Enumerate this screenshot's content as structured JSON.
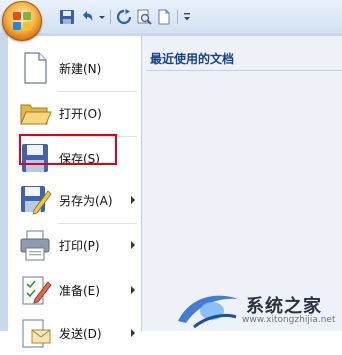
{
  "titlebar": {
    "quick_access": [
      "save-icon",
      "undo-icon",
      "redo-icon",
      "print-preview-icon",
      "new-doc-icon",
      "customize-dropdown-icon"
    ]
  },
  "office_button": {
    "icon": "office-logo-icon"
  },
  "menu": {
    "items": [
      {
        "label": "新建(N)",
        "icon": "new-document-icon",
        "has_submenu": false
      },
      {
        "label": "打开(O)",
        "icon": "open-folder-icon",
        "has_submenu": false,
        "highlighted": true
      },
      {
        "label": "保存(S)",
        "icon": "save-disk-icon",
        "has_submenu": false
      },
      {
        "label": "另存为(A)",
        "icon": "save-as-icon",
        "has_submenu": true
      },
      {
        "label": "打印(P)",
        "icon": "printer-icon",
        "has_submenu": true
      },
      {
        "label": "准备(E)",
        "icon": "prepare-icon",
        "has_submenu": true
      },
      {
        "label": "发送(D)",
        "icon": "send-icon",
        "has_submenu": true
      }
    ]
  },
  "recent": {
    "title": "最近使用的文档"
  },
  "watermark": {
    "text": "系统之家",
    "url": "www.xitongzhijia.net"
  },
  "colors": {
    "highlight": "#e0001a",
    "pane_bg": "#eef2f8",
    "frame": "#c9d9ed"
  }
}
